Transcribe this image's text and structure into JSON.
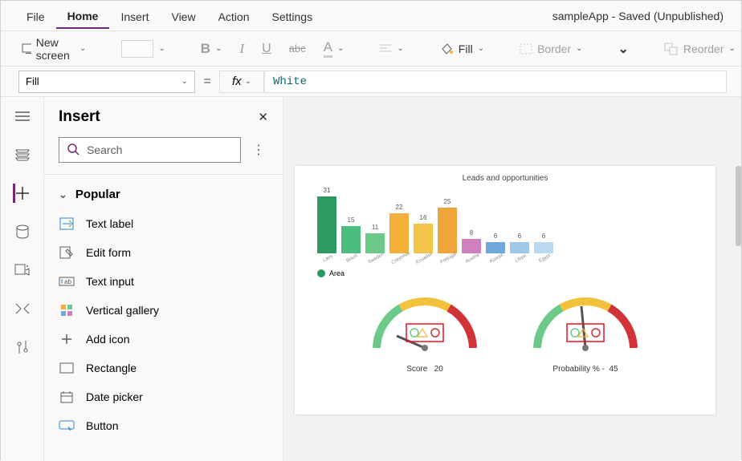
{
  "menu": {
    "items": [
      "File",
      "Home",
      "Insert",
      "View",
      "Action",
      "Settings"
    ],
    "active_index": 1
  },
  "app_status": "sampleApp - Saved (Unpublished)",
  "ribbon": {
    "new_screen": "New screen",
    "fill_label": "Fill",
    "border_label": "Border",
    "reorder_label": "Reorder"
  },
  "formula_bar": {
    "property": "Fill",
    "fx": "fx",
    "value": "White"
  },
  "insert_pane": {
    "title": "Insert",
    "search_placeholder": "Search",
    "group": "Popular",
    "items": [
      {
        "label": "Text label",
        "icon": "text-label-icon"
      },
      {
        "label": "Edit form",
        "icon": "edit-form-icon"
      },
      {
        "label": "Text input",
        "icon": "text-input-icon"
      },
      {
        "label": "Vertical gallery",
        "icon": "vertical-gallery-icon"
      },
      {
        "label": "Add icon",
        "icon": "add-icon-icon"
      },
      {
        "label": "Rectangle",
        "icon": "rectangle-icon"
      },
      {
        "label": "Date picker",
        "icon": "date-picker-icon"
      },
      {
        "label": "Button",
        "icon": "button-icon"
      }
    ]
  },
  "canvas": {
    "chart_title": "Leads and opportunities",
    "legend": "Area",
    "gauge1": {
      "label": "Score",
      "value": "20"
    },
    "gauge2": {
      "label": "Probability % -",
      "value": "45"
    }
  },
  "chart_data": {
    "type": "bar",
    "categories": [
      "Laos",
      "Brazil",
      "Sweden",
      "Colombia",
      "Ecuador",
      "Portugal",
      "Austria",
      "Kuwait",
      "Libya",
      "Egypt"
    ],
    "values": [
      31,
      15,
      11,
      22,
      16,
      25,
      8,
      6,
      6,
      6
    ],
    "title": "Leads and opportunities",
    "xlabel": "",
    "ylabel": "",
    "ylim": [
      0,
      35
    ],
    "colors": [
      "#2e9961",
      "#4bbd7e",
      "#6cc98a",
      "#f3b13b",
      "#f4c44a",
      "#f0a53a",
      "#d07ebe",
      "#6ea8dc",
      "#9fc8e8",
      "#b8d9f0"
    ]
  }
}
